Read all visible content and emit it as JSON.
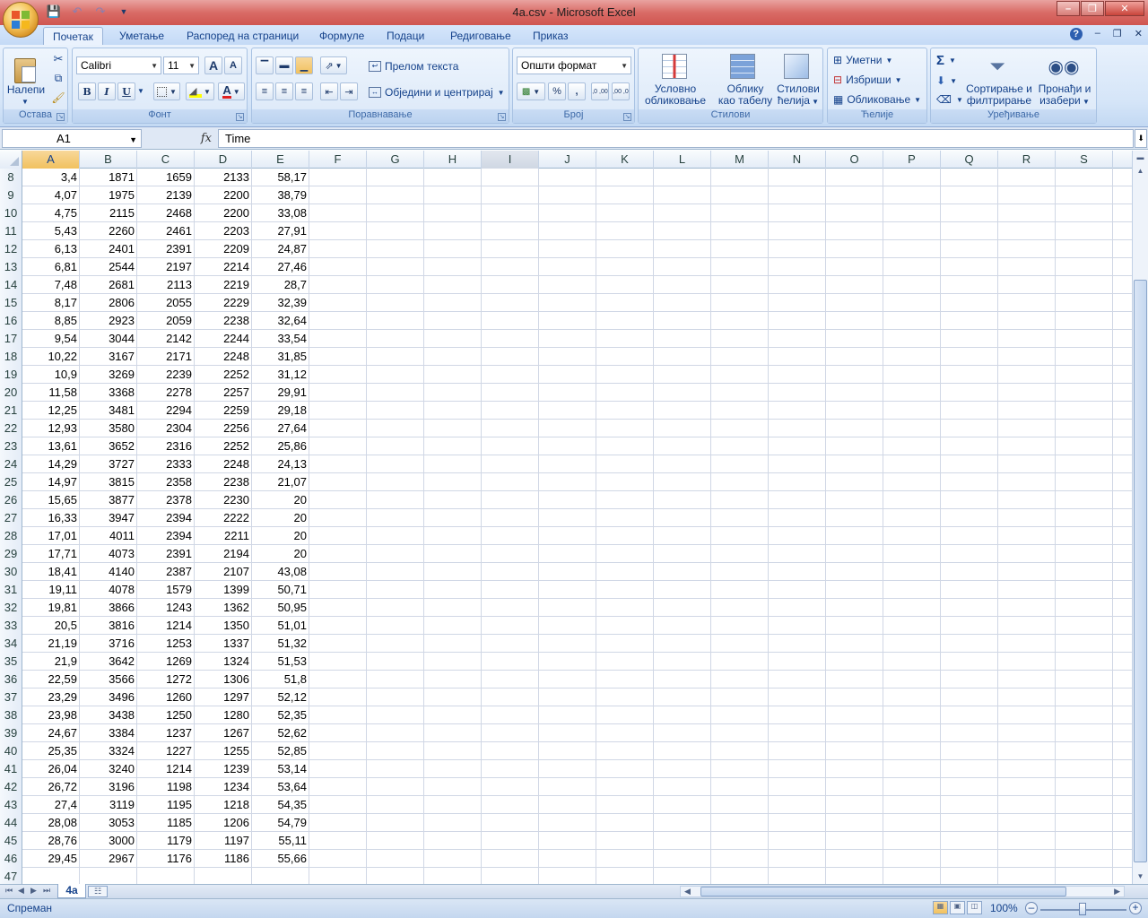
{
  "window": {
    "title": "4a.csv - Microsoft Excel",
    "minimize_icon": "minimize-icon",
    "maximize_icon": "restore-icon",
    "close_icon": "close-icon"
  },
  "tabs": [
    {
      "label": "Почетак",
      "active": true
    },
    {
      "label": "Уметање"
    },
    {
      "label": "Распоред на страници"
    },
    {
      "label": "Формуле"
    },
    {
      "label": "Подаци"
    },
    {
      "label": "Редиговање"
    },
    {
      "label": "Приказ"
    }
  ],
  "ribbon": {
    "clipboard": {
      "paste": "Налепи",
      "label": "Остава"
    },
    "font": {
      "name": "Calibri",
      "size": "11",
      "label": "Фонт",
      "bold": "B",
      "italic": "I",
      "underline": "U",
      "grow": "A",
      "shrink": "A",
      "font_color": "A"
    },
    "alignment": {
      "wrap": "Прелом текста",
      "merge": "Обједини и центрирај",
      "label": "Поравнавање"
    },
    "number": {
      "format": "Општи формат",
      "percent": "%",
      "comma": ",",
      "label": "Број",
      "inc_decimal": ",0 ,00",
      "dec_decimal": ",00 ,0"
    },
    "styles": {
      "conditional_1": "Условно",
      "conditional_2": "обликовање",
      "table_1": "Облику",
      "table_2": "као табелу",
      "cell_1": "Стилови",
      "cell_2": "ћелија",
      "label": "Стилови"
    },
    "cells": {
      "insert": "Уметни",
      "delete": "Избриши",
      "format": "Обликовање",
      "label": "Ћелије"
    },
    "editing": {
      "sum": "Σ",
      "sort_1": "Сортирање и",
      "sort_2": "филтрирање",
      "find_1": "Пронађи и",
      "find_2": "изабери",
      "label": "Уређивање"
    }
  },
  "formula_bar": {
    "name_box": "A1",
    "fx": "fx",
    "formula": "Time"
  },
  "columns": [
    "A",
    "B",
    "C",
    "D",
    "E",
    "F",
    "G",
    "H",
    "I",
    "J",
    "K",
    "L",
    "M",
    "N",
    "O",
    "P",
    "Q",
    "R",
    "S"
  ],
  "selected_column": "A",
  "highlighted_column": "I",
  "rows": [
    {
      "n": "8",
      "A": "3,4",
      "B": "1871",
      "C": "1659",
      "D": "2133",
      "E": "58,17"
    },
    {
      "n": "9",
      "A": "4,07",
      "B": "1975",
      "C": "2139",
      "D": "2200",
      "E": "38,79"
    },
    {
      "n": "10",
      "A": "4,75",
      "B": "2115",
      "C": "2468",
      "D": "2200",
      "E": "33,08"
    },
    {
      "n": "11",
      "A": "5,43",
      "B": "2260",
      "C": "2461",
      "D": "2203",
      "E": "27,91"
    },
    {
      "n": "12",
      "A": "6,13",
      "B": "2401",
      "C": "2391",
      "D": "2209",
      "E": "24,87"
    },
    {
      "n": "13",
      "A": "6,81",
      "B": "2544",
      "C": "2197",
      "D": "2214",
      "E": "27,46"
    },
    {
      "n": "14",
      "A": "7,48",
      "B": "2681",
      "C": "2113",
      "D": "2219",
      "E": "28,7"
    },
    {
      "n": "15",
      "A": "8,17",
      "B": "2806",
      "C": "2055",
      "D": "2229",
      "E": "32,39"
    },
    {
      "n": "16",
      "A": "8,85",
      "B": "2923",
      "C": "2059",
      "D": "2238",
      "E": "32,64"
    },
    {
      "n": "17",
      "A": "9,54",
      "B": "3044",
      "C": "2142",
      "D": "2244",
      "E": "33,54"
    },
    {
      "n": "18",
      "A": "10,22",
      "B": "3167",
      "C": "2171",
      "D": "2248",
      "E": "31,85"
    },
    {
      "n": "19",
      "A": "10,9",
      "B": "3269",
      "C": "2239",
      "D": "2252",
      "E": "31,12"
    },
    {
      "n": "20",
      "A": "11,58",
      "B": "3368",
      "C": "2278",
      "D": "2257",
      "E": "29,91"
    },
    {
      "n": "21",
      "A": "12,25",
      "B": "3481",
      "C": "2294",
      "D": "2259",
      "E": "29,18"
    },
    {
      "n": "22",
      "A": "12,93",
      "B": "3580",
      "C": "2304",
      "D": "2256",
      "E": "27,64"
    },
    {
      "n": "23",
      "A": "13,61",
      "B": "3652",
      "C": "2316",
      "D": "2252",
      "E": "25,86"
    },
    {
      "n": "24",
      "A": "14,29",
      "B": "3727",
      "C": "2333",
      "D": "2248",
      "E": "24,13"
    },
    {
      "n": "25",
      "A": "14,97",
      "B": "3815",
      "C": "2358",
      "D": "2238",
      "E": "21,07"
    },
    {
      "n": "26",
      "A": "15,65",
      "B": "3877",
      "C": "2378",
      "D": "2230",
      "E": "20"
    },
    {
      "n": "27",
      "A": "16,33",
      "B": "3947",
      "C": "2394",
      "D": "2222",
      "E": "20"
    },
    {
      "n": "28",
      "A": "17,01",
      "B": "4011",
      "C": "2394",
      "D": "2211",
      "E": "20"
    },
    {
      "n": "29",
      "A": "17,71",
      "B": "4073",
      "C": "2391",
      "D": "2194",
      "E": "20"
    },
    {
      "n": "30",
      "A": "18,41",
      "B": "4140",
      "C": "2387",
      "D": "2107",
      "E": "43,08"
    },
    {
      "n": "31",
      "A": "19,11",
      "B": "4078",
      "C": "1579",
      "D": "1399",
      "E": "50,71"
    },
    {
      "n": "32",
      "A": "19,81",
      "B": "3866",
      "C": "1243",
      "D": "1362",
      "E": "50,95"
    },
    {
      "n": "33",
      "A": "20,5",
      "B": "3816",
      "C": "1214",
      "D": "1350",
      "E": "51,01"
    },
    {
      "n": "34",
      "A": "21,19",
      "B": "3716",
      "C": "1253",
      "D": "1337",
      "E": "51,32"
    },
    {
      "n": "35",
      "A": "21,9",
      "B": "3642",
      "C": "1269",
      "D": "1324",
      "E": "51,53"
    },
    {
      "n": "36",
      "A": "22,59",
      "B": "3566",
      "C": "1272",
      "D": "1306",
      "E": "51,8"
    },
    {
      "n": "37",
      "A": "23,29",
      "B": "3496",
      "C": "1260",
      "D": "1297",
      "E": "52,12"
    },
    {
      "n": "38",
      "A": "23,98",
      "B": "3438",
      "C": "1250",
      "D": "1280",
      "E": "52,35"
    },
    {
      "n": "39",
      "A": "24,67",
      "B": "3384",
      "C": "1237",
      "D": "1267",
      "E": "52,62"
    },
    {
      "n": "40",
      "A": "25,35",
      "B": "3324",
      "C": "1227",
      "D": "1255",
      "E": "52,85"
    },
    {
      "n": "41",
      "A": "26,04",
      "B": "3240",
      "C": "1214",
      "D": "1239",
      "E": "53,14"
    },
    {
      "n": "42",
      "A": "26,72",
      "B": "3196",
      "C": "1198",
      "D": "1234",
      "E": "53,64"
    },
    {
      "n": "43",
      "A": "27,4",
      "B": "3119",
      "C": "1195",
      "D": "1218",
      "E": "54,35"
    },
    {
      "n": "44",
      "A": "28,08",
      "B": "3053",
      "C": "1185",
      "D": "1206",
      "E": "54,79"
    },
    {
      "n": "45",
      "A": "28,76",
      "B": "3000",
      "C": "1179",
      "D": "1197",
      "E": "55,11"
    },
    {
      "n": "46",
      "A": "29,45",
      "B": "2967",
      "C": "1176",
      "D": "1186",
      "E": "55,66"
    },
    {
      "n": "47",
      "A": "",
      "B": "",
      "C": "",
      "D": "",
      "E": ""
    }
  ],
  "sheet": {
    "tab": "4a"
  },
  "status": {
    "text": "Спреман",
    "zoom": "100%"
  },
  "colors": {
    "accent": "#15428b",
    "selection": "#f1c15f",
    "title_bar": "#d96b66"
  }
}
